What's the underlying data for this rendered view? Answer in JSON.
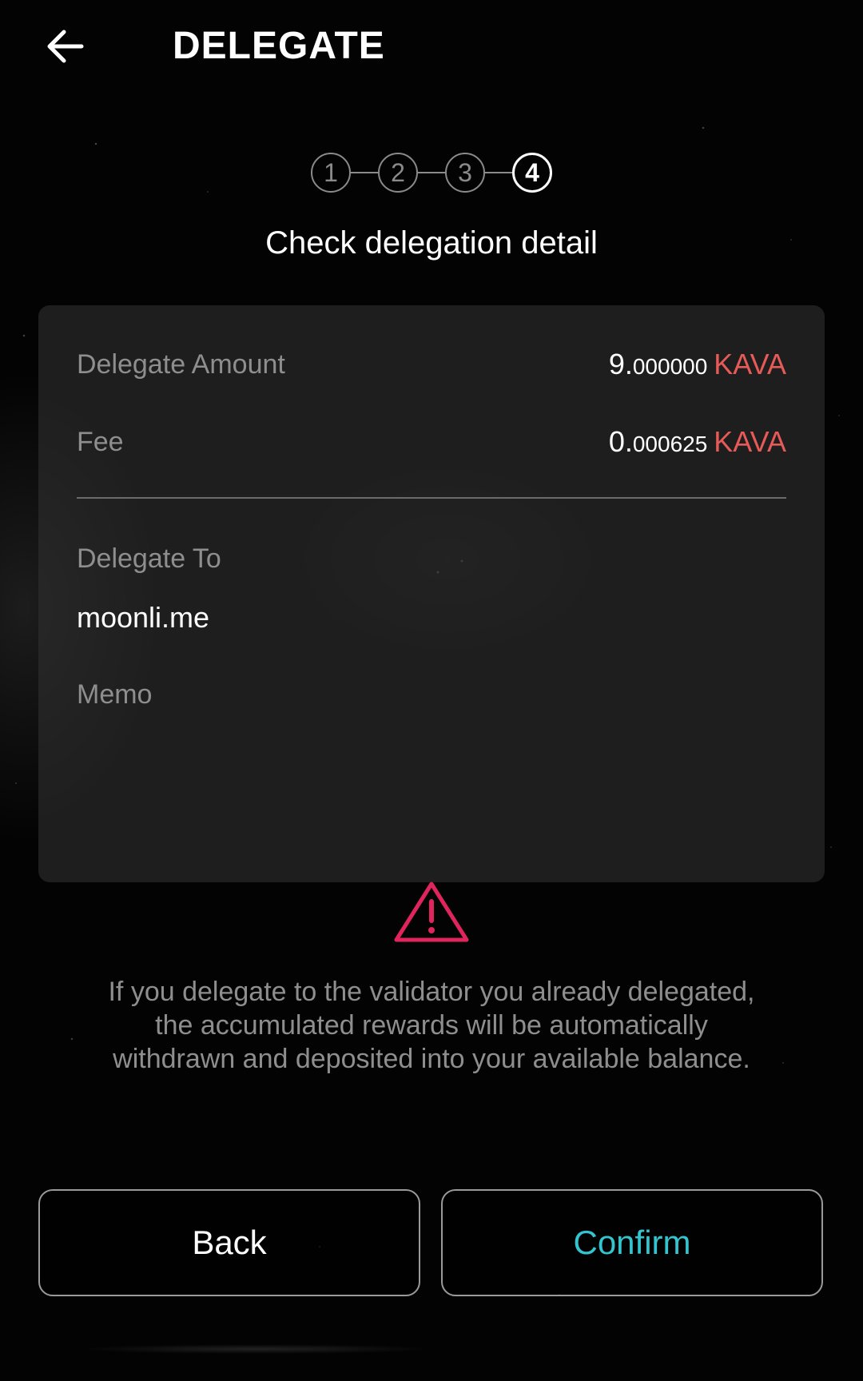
{
  "header": {
    "back_icon": "arrow-left-icon",
    "title": "DELEGATE"
  },
  "stepper": {
    "steps": [
      "1",
      "2",
      "3",
      "4"
    ],
    "active_step": 4,
    "title": "Check delegation detail"
  },
  "details": {
    "delegate_amount": {
      "label": "Delegate Amount",
      "integer": "9.",
      "decimal": "000000",
      "denom": "KAVA"
    },
    "fee": {
      "label": "Fee",
      "integer": "0.",
      "decimal": "000625",
      "denom": "KAVA"
    },
    "delegate_to": {
      "label": "Delegate To",
      "value": "moonli.me"
    },
    "memo": {
      "label": "Memo",
      "value": ""
    }
  },
  "warning": {
    "icon": "warning-triangle-icon",
    "text": "If you delegate to the validator you already delegated, the accumulated rewards will be automatically withdrawn and deposited into your available balance."
  },
  "buttons": {
    "back_label": "Back",
    "confirm_label": "Confirm"
  },
  "colors": {
    "denom": "#e65a58",
    "confirm": "#33c4cf",
    "warning": "#e0245e"
  }
}
